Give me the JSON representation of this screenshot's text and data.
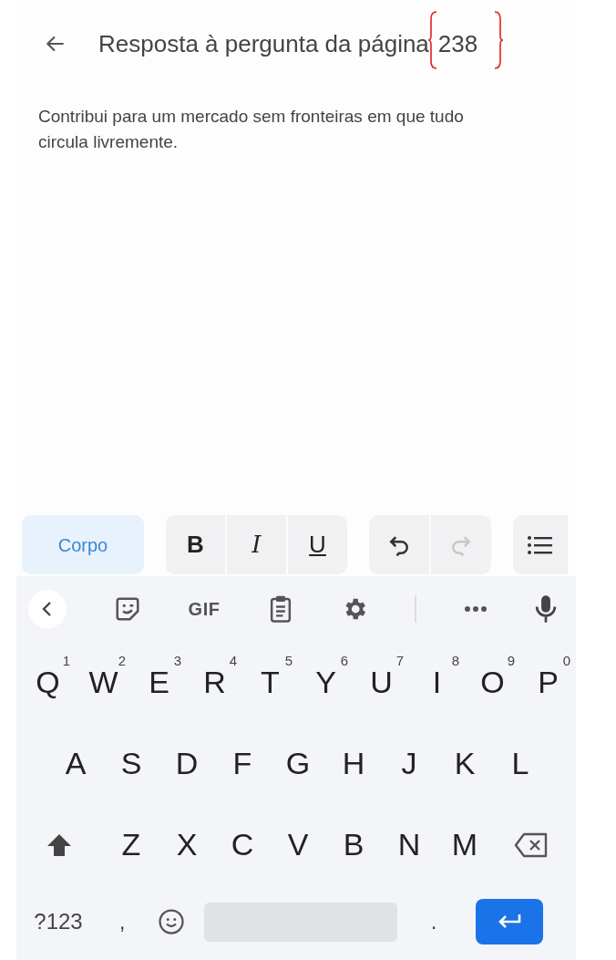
{
  "header": {
    "title": "Resposta à pergunta da página",
    "page_number": "238",
    "page_number_bracketed": true
  },
  "answer_text": "Contribui para um mercado sem fronteiras em que tudo circula livremente.",
  "format_toolbar": {
    "style_button": {
      "label": "Corpo",
      "selected": true
    },
    "text_buttons": [
      {
        "kind": "bold",
        "label": "B",
        "selected": false
      },
      {
        "kind": "italic",
        "label": "I",
        "selected": false
      },
      {
        "kind": "underline",
        "label": "U",
        "selected": false
      }
    ],
    "history_buttons": [
      {
        "kind": "undo",
        "disabled": false
      },
      {
        "kind": "redo",
        "disabled": true
      }
    ]
  },
  "keyboard": {
    "suggestion_strip": [
      {
        "kind": "collapse"
      },
      {
        "kind": "sticker"
      },
      {
        "kind": "gif",
        "label": "GIF"
      },
      {
        "kind": "clipboard"
      },
      {
        "kind": "settings"
      },
      {
        "kind": "divider"
      },
      {
        "kind": "more"
      },
      {
        "kind": "mic"
      }
    ],
    "rows": [
      [
        {
          "label": "Q",
          "hint": "1"
        },
        {
          "label": "W",
          "hint": "2"
        },
        {
          "label": "E",
          "hint": "3"
        },
        {
          "label": "R",
          "hint": "4"
        },
        {
          "label": "T",
          "hint": "5"
        },
        {
          "label": "Y",
          "hint": "6"
        },
        {
          "label": "U",
          "hint": "7"
        },
        {
          "label": "I",
          "hint": "8"
        },
        {
          "label": "O",
          "hint": "9"
        },
        {
          "label": "P",
          "hint": "0"
        }
      ],
      [
        {
          "label": "A"
        },
        {
          "label": "S"
        },
        {
          "label": "D"
        },
        {
          "label": "F"
        },
        {
          "label": "G"
        },
        {
          "label": "H"
        },
        {
          "label": "J"
        },
        {
          "label": "K"
        },
        {
          "label": "L"
        }
      ],
      [
        {
          "kind": "shift"
        },
        {
          "label": "Z"
        },
        {
          "label": "X"
        },
        {
          "label": "C"
        },
        {
          "label": "V"
        },
        {
          "label": "B"
        },
        {
          "label": "N"
        },
        {
          "label": "M"
        },
        {
          "kind": "backspace"
        }
      ]
    ],
    "bottom_row": [
      {
        "kind": "symbols",
        "label": "?123"
      },
      {
        "kind": "char",
        "label": ","
      },
      {
        "kind": "emoji"
      },
      {
        "kind": "space"
      },
      {
        "kind": "char",
        "label": "."
      },
      {
        "kind": "enter"
      }
    ]
  }
}
